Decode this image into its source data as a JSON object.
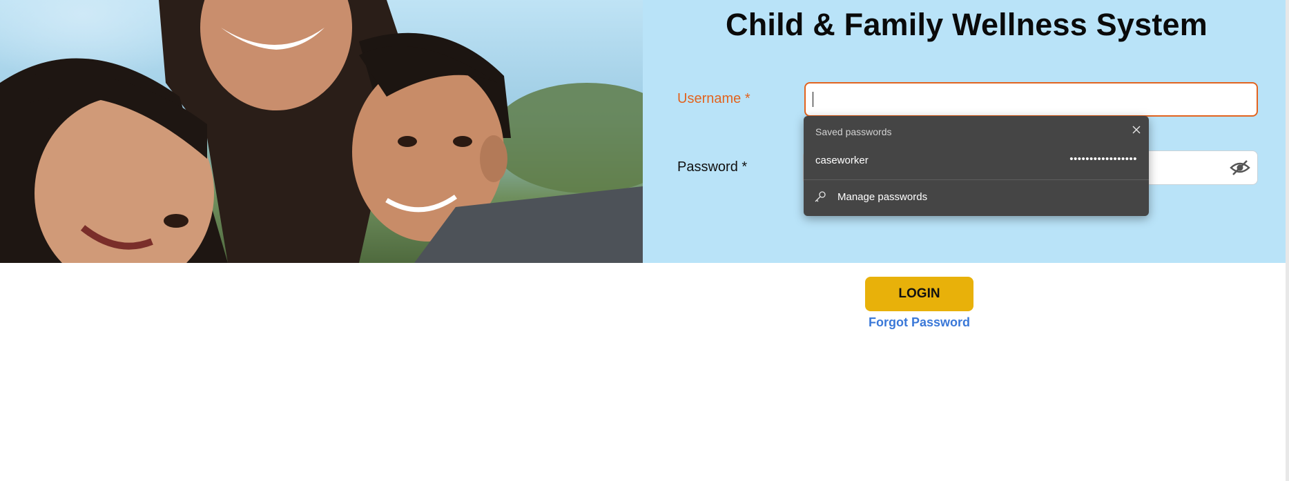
{
  "header": {
    "title": "Child & Family Wellness System"
  },
  "form": {
    "username_label": "Username *",
    "username_value": "",
    "password_label": "Password *",
    "password_value": ""
  },
  "saved_passwords": {
    "heading": "Saved passwords",
    "entries": [
      {
        "username": "caseworker",
        "masked_password": "•••••••••••••••••"
      }
    ],
    "manage_label": "Manage passwords"
  },
  "actions": {
    "login_label": "LOGIN",
    "forgot_label": "Forgot Password"
  },
  "colors": {
    "panel_bg": "#b9e3f8",
    "accent_orange": "#e2631e",
    "button_yellow": "#e8b10a",
    "link_blue": "#3a78d8",
    "popup_bg": "#454545"
  }
}
